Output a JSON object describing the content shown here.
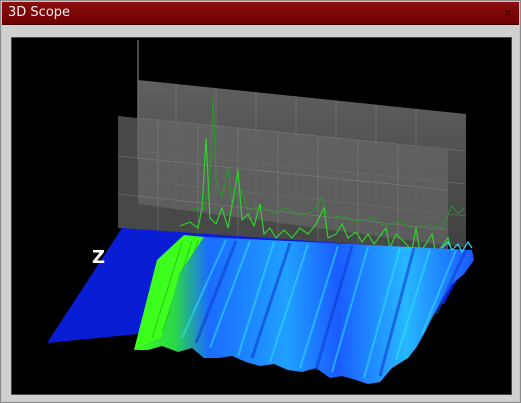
{
  "window": {
    "title": "3D Scope",
    "close_glyph": "x"
  },
  "scope": {
    "axis_label": "Z",
    "colors": {
      "background": "#000000",
      "floor": "#0a1fe0",
      "spectrum_trace": "#2fd12f",
      "panel": "#7a7a7a",
      "surface_near": "#1a5fff",
      "surface_mid": "#22a8ff",
      "surface_high": "#29e0ff",
      "surface_green": "#3cff1e"
    }
  }
}
